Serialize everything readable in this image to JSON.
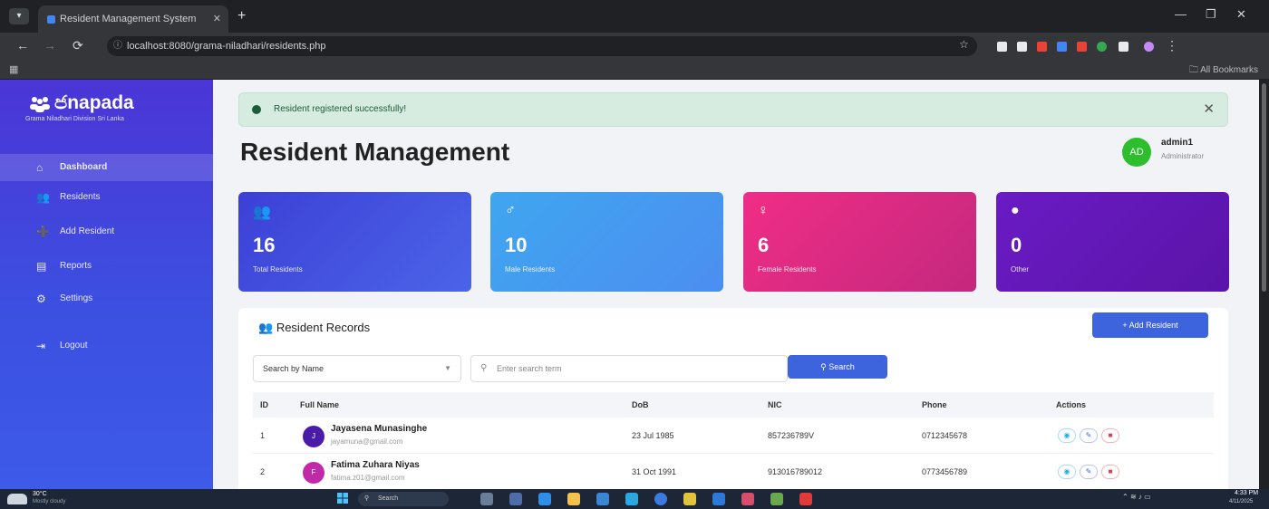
{
  "browser": {
    "tab_title": "Resident Management System",
    "url": "localhost:8080/grama-niladhari/residents.php",
    "bookmarks_label": "All Bookmarks",
    "ext_colors": [
      "#e8eaed",
      "#e8eaed",
      "#ea4335",
      "#4285f4",
      "#ea4335",
      "#34a853",
      "#e8eaed"
    ]
  },
  "sidebar": {
    "brand": "ජනපද",
    "brand_display": "ජnapada",
    "subtitle": "Grama Niladhari Division Sri Lanka",
    "items": [
      {
        "label": "Dashboard",
        "icon": "home-icon",
        "active": true
      },
      {
        "label": "Residents",
        "icon": "users-icon",
        "active": false
      },
      {
        "label": "Add Resident",
        "icon": "user-plus-icon",
        "active": false
      },
      {
        "label": "Reports",
        "icon": "chart-icon",
        "active": false
      },
      {
        "label": "Settings",
        "icon": "gear-icon",
        "active": false
      },
      {
        "label": "Logout",
        "icon": "logout-icon",
        "active": false
      }
    ]
  },
  "alert": {
    "message": "Resident registered successfully!"
  },
  "header": {
    "title": "Resident Management",
    "avatar": "AD",
    "user_name": "admin1",
    "user_role": "Administrator"
  },
  "stats": [
    {
      "value": "16",
      "label": "Total Residents",
      "icon": "users-icon",
      "color_from": "#3c40d6",
      "color_to": "#4b64e8"
    },
    {
      "value": "10",
      "label": "Male Residents",
      "icon": "male-icon",
      "color_from": "#3fa6f0",
      "color_to": "#4c8ef0"
    },
    {
      "value": "6",
      "label": "Female Residents",
      "icon": "female-icon",
      "color_from": "#f02d86",
      "color_to": "#c4287e"
    },
    {
      "value": "0",
      "label": "Other",
      "icon": "user-icon",
      "color_from": "#6a1bc4",
      "color_to": "#5a14a8"
    }
  ],
  "records": {
    "title": "Resident Records",
    "add_button": "+ Add Resident",
    "search_select": "Search by Name",
    "search_placeholder": "Enter search term",
    "search_button": "Search",
    "columns": [
      "ID",
      "Full Name",
      "DoB",
      "NIC",
      "Phone",
      "Actions"
    ],
    "rows": [
      {
        "id": "1",
        "initial": "J",
        "avatar_color": "#4a1aa8",
        "name": "Jayasena Munasinghe",
        "email": "jayamuna@gmail.com",
        "dob": "23 Jul 1985",
        "nic": "857236789V",
        "phone": "0712345678"
      },
      {
        "id": "2",
        "initial": "F",
        "avatar_color": "#c02aa8",
        "name": "Fatima Zuhara Niyas",
        "email": "fatima.z01@gmail.com",
        "dob": "31 Oct 1991",
        "nic": "913016789012",
        "phone": "0773456789"
      }
    ]
  },
  "taskbar": {
    "temp": "30°C",
    "weather": "Mostly cloudy",
    "search": "Search",
    "time": "4:33 PM",
    "date": "4/11/2025"
  }
}
